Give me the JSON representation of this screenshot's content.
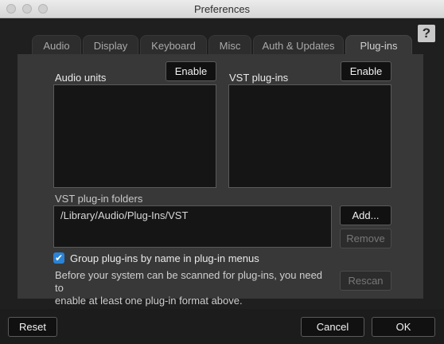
{
  "window": {
    "title": "Preferences"
  },
  "help": {
    "label": "?"
  },
  "tabs": [
    {
      "label": "Audio"
    },
    {
      "label": "Display"
    },
    {
      "label": "Keyboard"
    },
    {
      "label": "Misc"
    },
    {
      "label": "Auth & Updates"
    },
    {
      "label": "Plug-ins"
    }
  ],
  "audio_units": {
    "label": "Audio units",
    "enable_label": "Enable"
  },
  "vst": {
    "label": "VST plug-ins",
    "enable_label": "Enable"
  },
  "folders": {
    "label": "VST plug-in folders",
    "items": [
      "/Library/Audio/Plug-Ins/VST"
    ],
    "add_label": "Add...",
    "remove_label": "Remove"
  },
  "group": {
    "checked": true,
    "label": "Group plug-ins by name in plug-in menus"
  },
  "info": {
    "line1": "Before your system can be scanned for plug-ins, you need to",
    "line2": "enable at least one plug-in format above."
  },
  "rescan_label": "Rescan",
  "footer": {
    "reset_label": "Reset",
    "cancel_label": "Cancel",
    "ok_label": "OK"
  },
  "colors": {
    "accent": "#2a83d6",
    "panel": "#383838",
    "background": "#1f1f1f"
  }
}
